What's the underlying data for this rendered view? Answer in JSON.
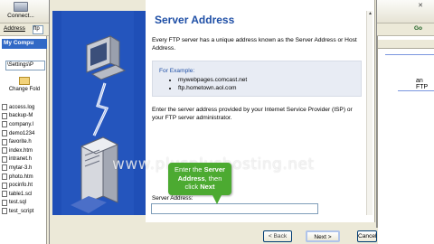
{
  "background_app": {
    "connect_label": "Connect...",
    "address_label": "Address",
    "address_value": "ftp",
    "go_label": "Go",
    "left_pane": {
      "tab_label": "My Compu",
      "path": "\\Settings\\P",
      "change_folder_label": "Change Fold",
      "files": [
        "access.log",
        "backup-M",
        "company.l",
        "demo1234",
        "favorite.h",
        "index.htm",
        "intranet.h",
        "mytar-3.h",
        "photo.htm",
        "pocinfo.ht",
        "table1.scl",
        "test.sql",
        "test_script"
      ]
    },
    "right_pane": {
      "visible_text": "an FTP"
    }
  },
  "wizard": {
    "title": "Server Address",
    "description": "Every FTP server has a unique address known as the Server Address or Host Address.",
    "example_label": "For Example:",
    "examples": [
      "mywebpages.comcast.net",
      "ftp.hometown.aol.com"
    ],
    "instruction": "Enter the server address provided by your Internet Service Provider (ISP) or your FTP server administrator.",
    "server_address_label": "Server Address:",
    "server_address_value": "",
    "buttons": {
      "back": "< Back",
      "next": "Next >",
      "cancel": "Cancel"
    }
  },
  "callout": {
    "line1": "Enter the",
    "line1_bold": "Server",
    "line2_bold": "Address",
    "line2": ", then",
    "line3": "click",
    "line3_bold": "Next"
  },
  "watermark": "www.plusplushosting.net",
  "colors": {
    "title_blue": "#1f4fa6",
    "art_blue": "#1f4fb7",
    "callout_green": "#4caa31",
    "selection_blue": "#3169c6"
  }
}
